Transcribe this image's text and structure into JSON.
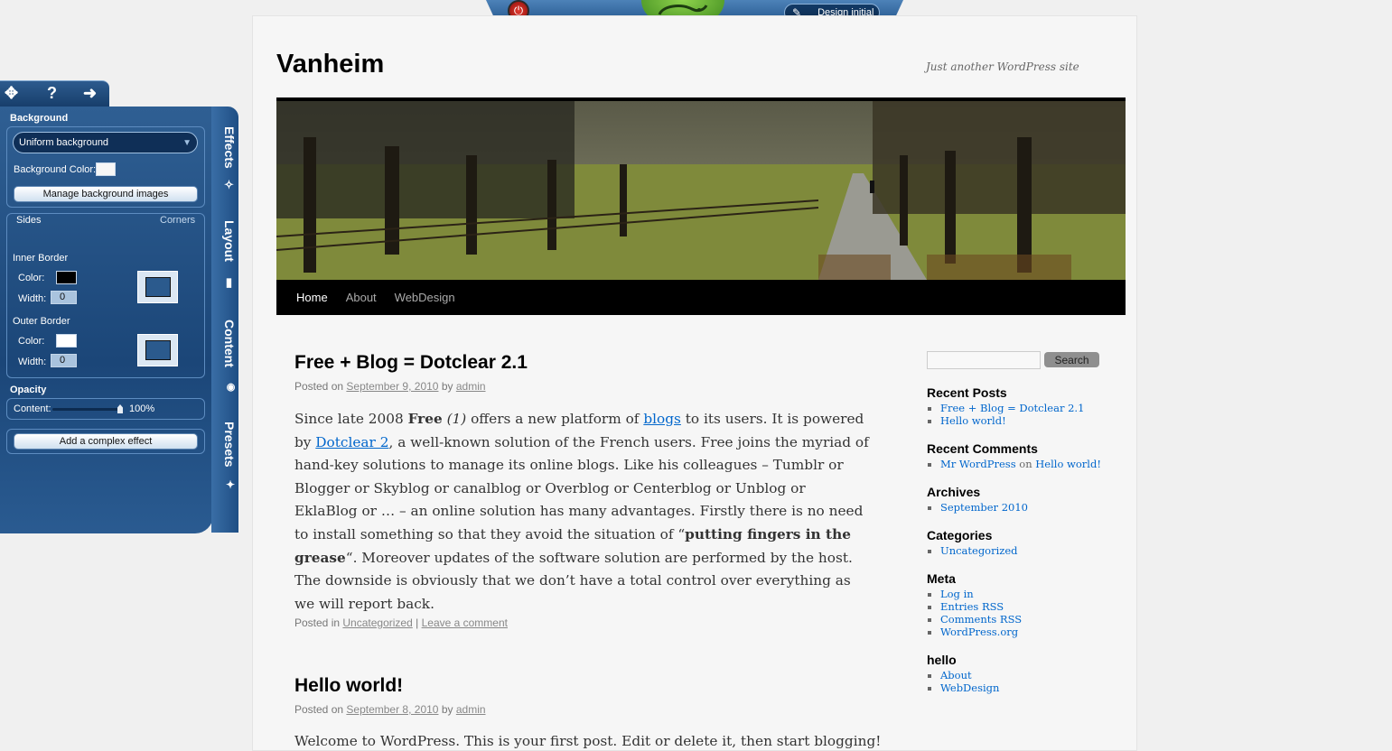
{
  "toolbar": {
    "design_label": "Design initial",
    "power_icon": "power-icon",
    "logo_icon": "chameleon-logo-icon"
  },
  "site": {
    "title": "Vanheim",
    "tagline": "Just another WordPress site"
  },
  "nav": {
    "items": [
      "Home",
      "About",
      "WebDesign"
    ],
    "active": "Home"
  },
  "posts": [
    {
      "title": "Free + Blog = Dotclear 2.1",
      "posted_on": "Posted on",
      "date": "September 9, 2010",
      "by": "by",
      "author": "admin",
      "body": {
        "p1": "Since late 2008 ",
        "free": "Free",
        "one": " (1)",
        "p2": " offers a new platform of ",
        "link_blogs": "blogs",
        "p3": " to its users. It is powered by ",
        "link_dotclear": "Dotclear 2",
        "p4": ", a well-known solution of the French users. Free joins the myriad of hand-key solutions to manage its online blogs. Like his colleagues – Tumblr or Blogger or Skyblog or canalblog or Overblog or Centerblog or Unblog or EklaBlog or … – an online solution has many advantages. Firstly there is no need to install something so that they avoid the situation of “",
        "bold_phrase": "putting fingers in the grease",
        "p5": "“. Moreover updates of the software solution are performed by the host. The downside is obviously that we don’t have a total control over everything as we will report back."
      },
      "posted_in": "Posted in",
      "category": "Uncategorized",
      "separator": "|",
      "comment_link": "Leave a comment"
    },
    {
      "title": "Hello world!",
      "posted_on": "Posted on",
      "date": "September 8, 2010",
      "by": "by",
      "author": "admin",
      "body": "Welcome to WordPress. This is your first post. Edit or delete it, then start blogging!"
    }
  ],
  "sidebar": {
    "search_button": "Search",
    "recent_posts": {
      "title": "Recent Posts",
      "items": [
        "Free + Blog = Dotclear 2.1",
        "Hello world!"
      ]
    },
    "recent_comments": {
      "title": "Recent Comments",
      "author": "Mr WordPress",
      "on": "on",
      "post": "Hello world!"
    },
    "archives": {
      "title": "Archives",
      "items": [
        "September 2010"
      ]
    },
    "categories": {
      "title": "Categories",
      "items": [
        "Uncategorized"
      ]
    },
    "meta": {
      "title": "Meta",
      "items": [
        "Log in",
        "Entries RSS",
        "Comments RSS",
        "WordPress.org"
      ]
    },
    "hello": {
      "title": "hello",
      "items": [
        "About",
        "WebDesign"
      ]
    }
  },
  "editor": {
    "top_icons": [
      "target-icon",
      "help-icon",
      "arrow-right-icon"
    ],
    "help_glyph": "?",
    "background_title": "Background",
    "background_select": "Uniform background",
    "background_color_label": "Background Color:",
    "manage_images": "Manage background images",
    "tab_sides": "Sides",
    "tab_corners": "Corners",
    "inner_border": "Inner Border",
    "outer_border": "Outer Border",
    "color_label": "Color:",
    "width_label": "Width:",
    "inner_width": "0",
    "outer_width": "0",
    "opacity_title": "Opacity",
    "content_label": "Content:",
    "content_opacity": "100%",
    "opacity_value": 1.0,
    "add_effect": "Add a complex effect",
    "side_tabs": [
      "Effects",
      "Layout",
      "Content",
      "Presets"
    ],
    "colors": {
      "inner_border": "#000000",
      "outer_border": "#ffffff",
      "background": "#f6f6f6"
    }
  }
}
